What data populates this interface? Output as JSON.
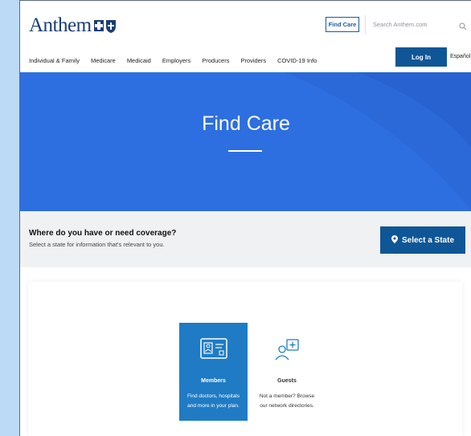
{
  "header": {
    "logo_text": "Anthem",
    "find_care_button": "Find Care",
    "search_placeholder": "Search Anthem.com",
    "login_button": "Log In",
    "language_link": "Español"
  },
  "nav": {
    "items": [
      {
        "label": "Individual & Family"
      },
      {
        "label": "Medicare"
      },
      {
        "label": "Medicaid"
      },
      {
        "label": "Employers"
      },
      {
        "label": "Producers"
      },
      {
        "label": "Providers"
      },
      {
        "label": "COVID-19 Info"
      }
    ]
  },
  "hero": {
    "title": "Find Care"
  },
  "coverage": {
    "title": "Where do you have or need coverage?",
    "subtitle": "Select a state for information that's relevant to you.",
    "select_state_button": "Select a State"
  },
  "cards": {
    "members": {
      "title": "Members",
      "desc_line1": "Find doctors, hospitals",
      "desc_line2": "and more in your plan."
    },
    "guests": {
      "title": "Guests",
      "desc_line1": "Not a member? Browse",
      "desc_line2": "our network directories."
    }
  },
  "colors": {
    "hero_bg": "#2d6fe0",
    "primary_button": "#0f5697",
    "members_card": "#1f7bc4",
    "logo": "#1a3e75",
    "page_bg": "#bcdaf5"
  }
}
